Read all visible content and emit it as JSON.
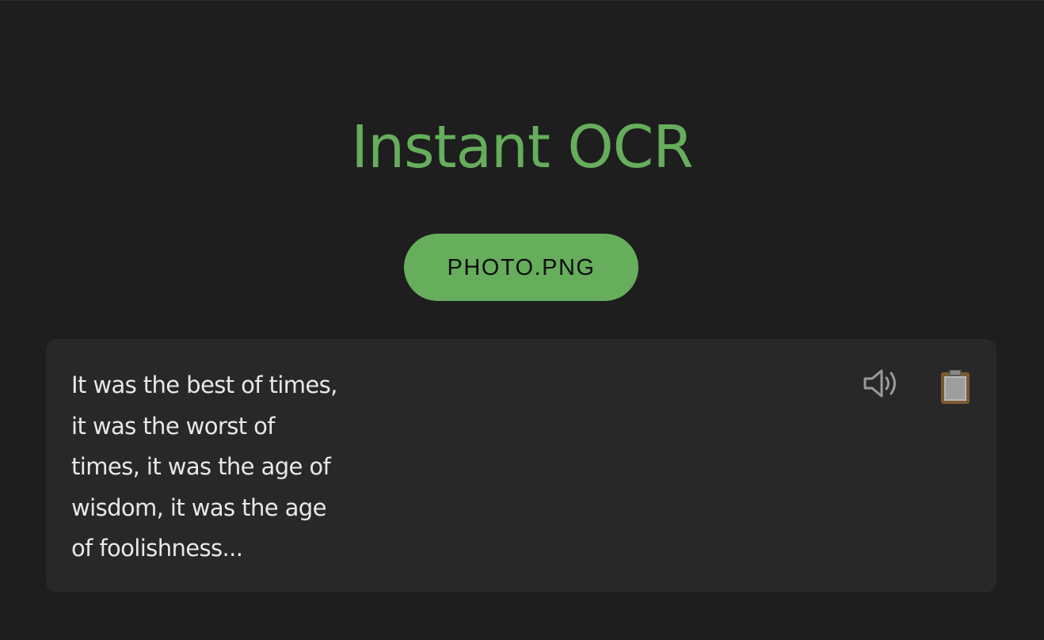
{
  "app": {
    "title": "Instant OCR"
  },
  "upload": {
    "file_button_label": "PHOTO.PNG"
  },
  "result": {
    "ocr_text": "It was the best of times, it was the worst of times, it was the age of wisdom, it was the age of foolishness...",
    "speak_icon": "speaker-icon",
    "copy_icon": "clipboard-icon"
  },
  "colors": {
    "background": "#1e1e1e",
    "panel": "#282828",
    "accent": "#66ad5c",
    "text": "#e8e8e8"
  }
}
